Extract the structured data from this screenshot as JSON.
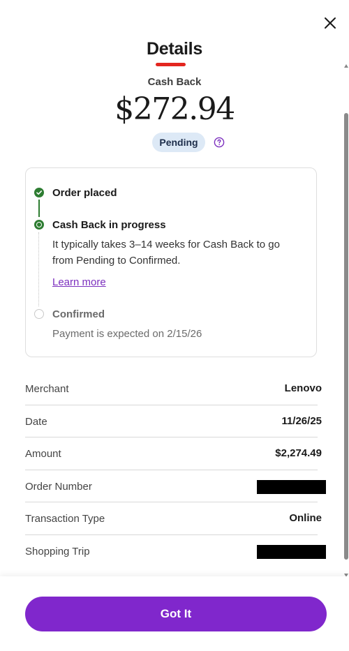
{
  "header": {
    "title": "Details",
    "close_icon": "close-icon"
  },
  "cash_back": {
    "label": "Cash Back",
    "amount": "$272.94",
    "status": "Pending",
    "help_icon": "question-circle-icon"
  },
  "timeline": {
    "steps": [
      {
        "title": "Order placed",
        "state": "done"
      },
      {
        "title": "Cash Back in progress",
        "state": "current",
        "description": "It typically takes 3–14 weeks for Cash Back to go from Pending to Confirmed.",
        "link": "Learn more"
      },
      {
        "title": "Confirmed",
        "state": "pending",
        "description": "Payment is expected on 2/15/26"
      }
    ]
  },
  "details": [
    {
      "label": "Merchant",
      "value": "Lenovo"
    },
    {
      "label": "Date",
      "value": "11/26/25"
    },
    {
      "label": "Amount",
      "value": "$2,274.49"
    },
    {
      "label": "Order Number",
      "value": null,
      "redacted": true
    },
    {
      "label": "Transaction Type",
      "value": "Online"
    },
    {
      "label": "Shopping Trip",
      "value": null,
      "redacted": true
    }
  ],
  "footer": {
    "button_label": "Got It"
  },
  "colors": {
    "accent_purple": "#8027cc",
    "success_green": "#2e7d32",
    "title_underline_red": "#e3261f",
    "pending_badge_bg": "#dde9f6"
  }
}
